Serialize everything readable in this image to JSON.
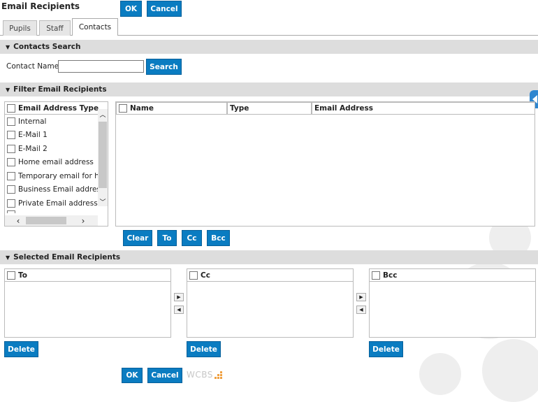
{
  "window": {
    "title": "Email Recipients"
  },
  "top_buttons": {
    "ok": "OK",
    "cancel": "Cancel"
  },
  "tabs": [
    {
      "label": "Pupils",
      "active": false
    },
    {
      "label": "Staff",
      "active": false
    },
    {
      "label": "Contacts",
      "active": true
    }
  ],
  "contacts_search": {
    "heading": "Contacts Search",
    "name_label": "Contact Name",
    "name_value": "",
    "search_button": "Search"
  },
  "filter": {
    "heading": "Filter Email Recipients",
    "types_header": "Email Address Types",
    "types": [
      "Internal",
      "E-Mail 1",
      "E-Mail 2",
      "Home email address",
      "Temporary email for h",
      "Business Email addres",
      "Private Email address"
    ],
    "grid_columns": [
      "Name",
      "Type",
      "Email Address"
    ],
    "actions": {
      "clear": "Clear",
      "to": "To",
      "cc": "Cc",
      "bcc": "Bcc"
    }
  },
  "selected": {
    "heading": "Selected Email Recipients",
    "to_header": "To",
    "cc_header": "Cc",
    "bcc_header": "Bcc",
    "delete_label": "Delete"
  },
  "bottom_buttons": {
    "ok": "OK",
    "cancel": "Cancel"
  },
  "logo_text": "WCBS",
  "colors": {
    "accent": "#0a7cc1",
    "section_bg": "#dddddd",
    "side_tab": "#2f86cf"
  }
}
